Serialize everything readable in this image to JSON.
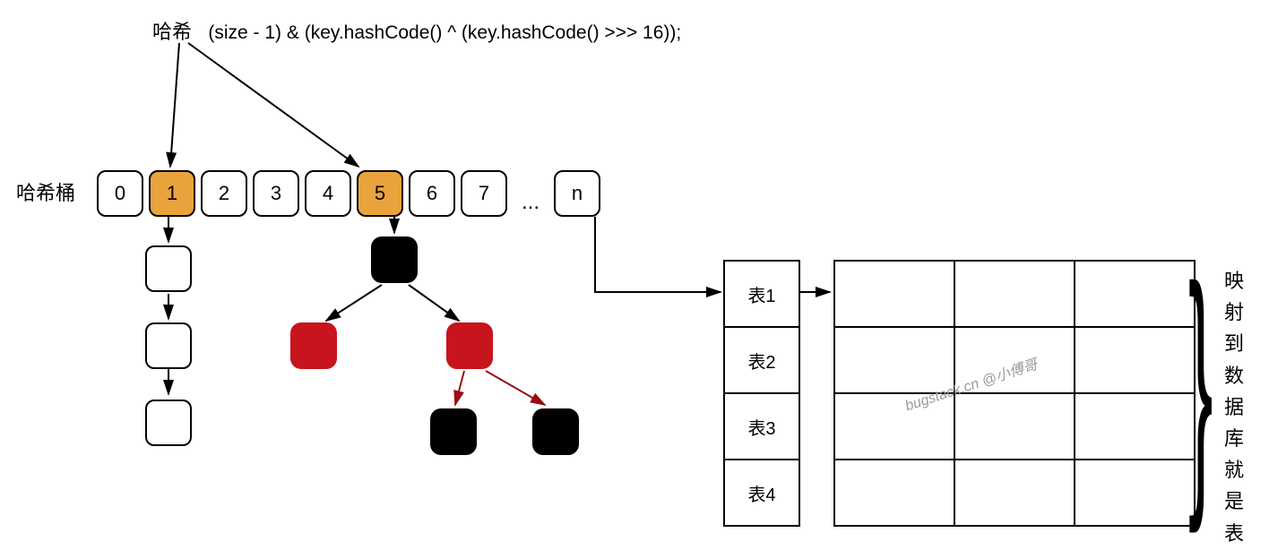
{
  "title": {
    "hash_label": "哈希",
    "hash_code": "(size - 1) & (key.hashCode() ^ (key.hashCode() >>> 16));"
  },
  "bucket_label": "哈希桶",
  "buckets": [
    "0",
    "1",
    "2",
    "3",
    "4",
    "5",
    "6",
    "7"
  ],
  "buckets_ellipsis": "...",
  "bucket_n": "n",
  "highlight_indices": [
    1,
    5
  ],
  "chain_length": 3,
  "tables": [
    "表1",
    "表2",
    "表3",
    "表4"
  ],
  "db_grid": {
    "rows": 4,
    "cols": 3
  },
  "right_text": "映射到数据库就是表",
  "watermark": "bugstack.cn @小傅哥",
  "chart_data": {
    "type": "diagram",
    "title": "HashMap hash bucket → sharded tables mapping",
    "hash_formula": "(size - 1) & (key.hashCode() ^ (key.hashCode() >>> 16))",
    "buckets": {
      "count_shown": 8,
      "indices": [
        0,
        1,
        2,
        3,
        4,
        5,
        6,
        7
      ],
      "continues_as": "n"
    },
    "highlighted_buckets": [
      1,
      5
    ],
    "bucket_1": {
      "structure": "linked-list",
      "nodes": 3
    },
    "bucket_5": {
      "structure": "red-black-tree",
      "nodes": [
        {
          "color": "black",
          "pos": "root"
        },
        {
          "color": "red",
          "pos": "left"
        },
        {
          "color": "red",
          "pos": "right"
        },
        {
          "color": "black",
          "pos": "right-left"
        },
        {
          "color": "black",
          "pos": "right-right"
        }
      ]
    },
    "bucket_n": {
      "maps_to": "table list"
    },
    "table_list": [
      "表1",
      "表2",
      "表3",
      "表4"
    ],
    "db_grid": {
      "rows": 4,
      "cols": 3
    },
    "annotation_right": "映射到数据库就是表"
  }
}
